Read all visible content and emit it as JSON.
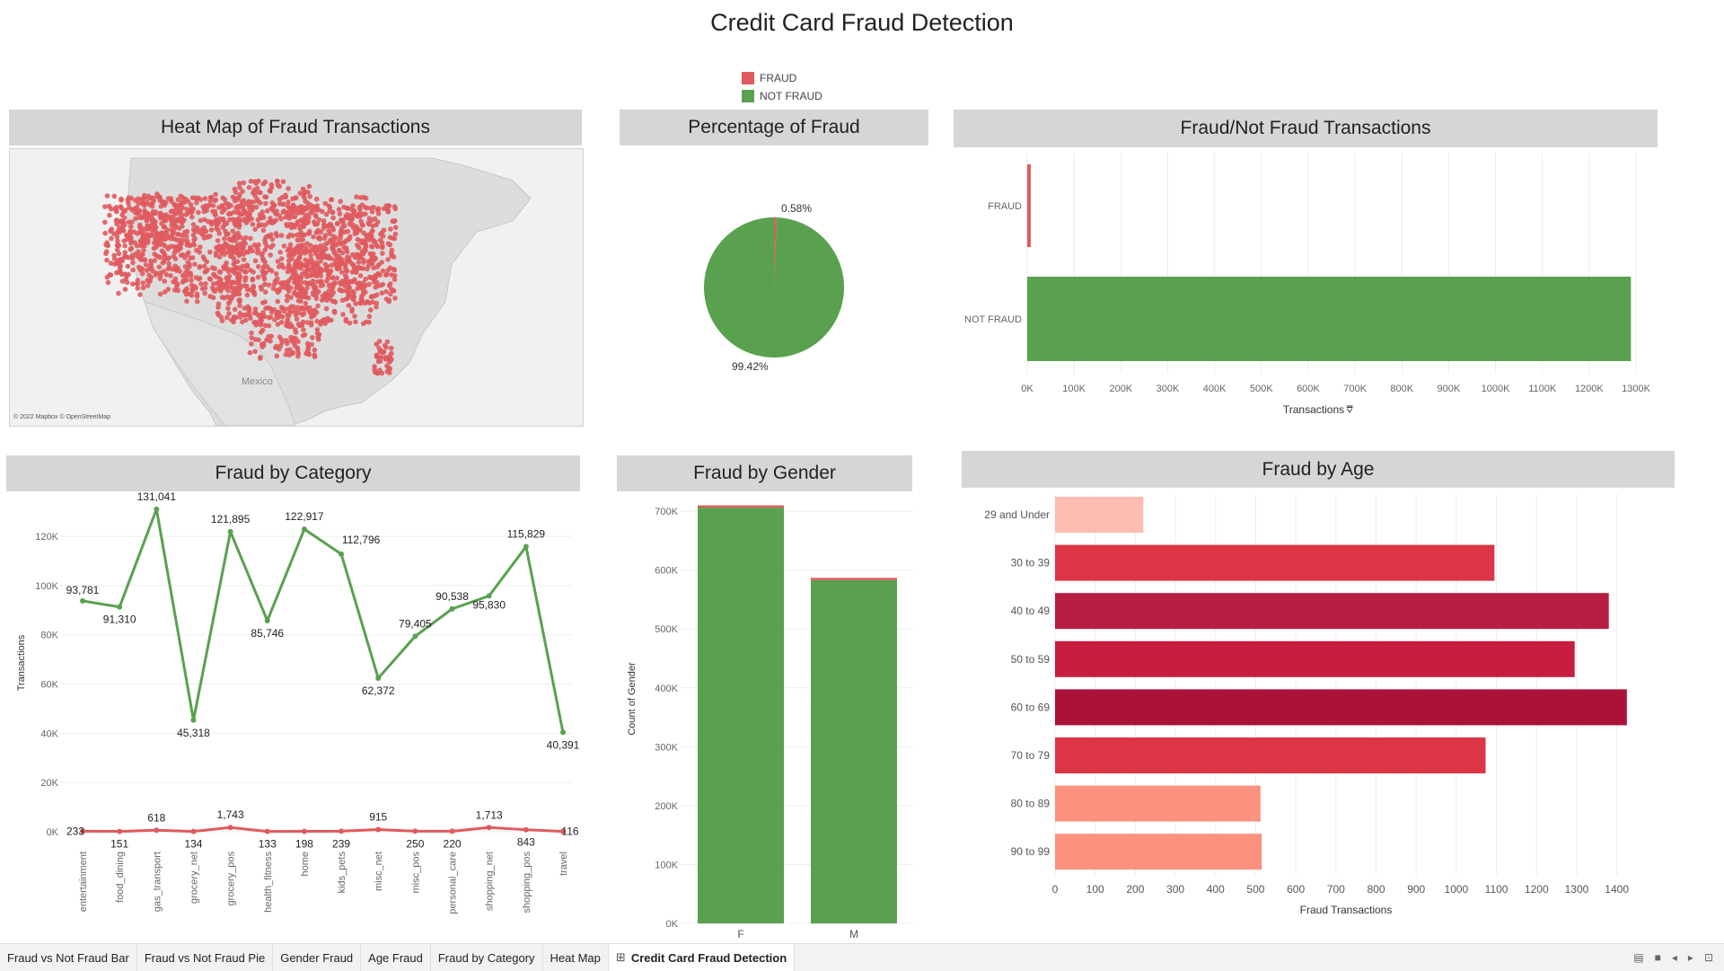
{
  "dashboard_title": "Credit Card Fraud Detection",
  "legend": [
    {
      "label": "FRAUD",
      "color": "#e05a5e"
    },
    {
      "label": "NOT FRAUD",
      "color": "#59a14f"
    }
  ],
  "panels": {
    "heatmap": {
      "title": "Heat Map of Fraud Transactions",
      "map_label": "Mexico",
      "attribution": "© 2022 Mapbox © OpenStreetMap"
    },
    "pie": {
      "title": "Percentage of Fraud"
    },
    "fraud_bar": {
      "title": "Fraud/Not Fraud Transactions"
    },
    "category": {
      "title": "Fraud by Category"
    },
    "gender": {
      "title": "Fraud by Gender"
    },
    "age": {
      "title": "Fraud by Age"
    }
  },
  "chart_data": [
    {
      "id": "pie",
      "type": "pie",
      "title": "Percentage of Fraud",
      "slices": [
        {
          "label": "FRAUD",
          "value": 0.58,
          "display": "0.58%",
          "color": "#e05a5e"
        },
        {
          "label": "NOT FRAUD",
          "value": 99.42,
          "display": "99.42%",
          "color": "#59a14f"
        }
      ]
    },
    {
      "id": "fraud_bar",
      "type": "bar",
      "orientation": "horizontal",
      "title": "Fraud/Not Fraud Transactions",
      "categories": [
        "FRAUD",
        "NOT FRAUD"
      ],
      "values": [
        7506,
        1289169
      ],
      "colors": [
        "#e05a5e",
        "#59a14f"
      ],
      "xlabel": "Transactions",
      "xlim": [
        0,
        1300000
      ],
      "xticks": [
        "0K",
        "100K",
        "200K",
        "300K",
        "400K",
        "500K",
        "600K",
        "700K",
        "800K",
        "900K",
        "1000K",
        "1100K",
        "1200K",
        "1300K"
      ]
    },
    {
      "id": "category",
      "type": "line",
      "title": "Fraud by Category",
      "ylabel": "Transactions",
      "ylim": [
        0,
        135000
      ],
      "yticks": [
        {
          "v": 0,
          "t": "0K"
        },
        {
          "v": 20000,
          "t": "20K"
        },
        {
          "v": 40000,
          "t": "40K"
        },
        {
          "v": 60000,
          "t": "60K"
        },
        {
          "v": 80000,
          "t": "80K"
        },
        {
          "v": 100000,
          "t": "100K"
        },
        {
          "v": 120000,
          "t": "120K"
        }
      ],
      "categories": [
        "entertainment",
        "food_dining",
        "gas_transport",
        "grocery_net",
        "grocery_pos",
        "health_fitness",
        "home",
        "kids_pets",
        "misc_net",
        "misc_pos",
        "personal_care",
        "shopping_net",
        "shopping_pos",
        "travel"
      ],
      "series": [
        {
          "name": "NOT FRAUD",
          "color": "#59a14f",
          "values": [
            93781,
            91310,
            131041,
            45318,
            121895,
            85746,
            122917,
            112796,
            62372,
            79405,
            90538,
            95830,
            115829,
            40391
          ],
          "labels": [
            "93,781",
            "91,310",
            "131,041",
            "45,318",
            "121,895",
            "85,746",
            "122,917",
            "112,796",
            "62,372",
            "79,405",
            "90,538",
            "95,830",
            "115,829",
            "40,391"
          ]
        },
        {
          "name": "FRAUD",
          "color": "#e05a5e",
          "values": [
            233,
            151,
            618,
            134,
            1743,
            133,
            198,
            239,
            915,
            250,
            220,
            1713,
            843,
            116
          ],
          "labels": [
            "233",
            "151",
            "618",
            "134",
            "1,743",
            "133",
            "198",
            "239",
            "915",
            "250",
            "220",
            "1,713",
            "843",
            "116"
          ]
        }
      ]
    },
    {
      "id": "gender",
      "type": "bar",
      "stacked": true,
      "title": "Fraud by Gender",
      "ylabel": "Count of Gender",
      "ylim": [
        0,
        720000
      ],
      "yticks": [
        "0K",
        "100K",
        "200K",
        "300K",
        "400K",
        "500K",
        "600K",
        "700K"
      ],
      "categories": [
        "F",
        "M"
      ],
      "series": [
        {
          "name": "NOT FRAUD",
          "color": "#59a14f",
          "values": [
            706128,
            583041
          ]
        },
        {
          "name": "FRAUD",
          "color": "#e05a5e",
          "values": [
            3735,
            3771
          ]
        }
      ]
    },
    {
      "id": "age",
      "type": "bar",
      "orientation": "horizontal",
      "title": "Fraud by Age",
      "xlabel": "Fraud Transactions",
      "xlim": [
        0,
        1450
      ],
      "xticks": [
        "0",
        "100",
        "200",
        "300",
        "400",
        "500",
        "600",
        "700",
        "800",
        "900",
        "1000",
        "1100",
        "1200",
        "1300",
        "1400"
      ],
      "categories": [
        "29 and Under",
        "30 to 39",
        "40 to 49",
        "50 to 59",
        "60 to 69",
        "70 to 79",
        "80 to 89",
        "90 to 99"
      ],
      "values": [
        220,
        1095,
        1380,
        1295,
        1425,
        1073,
        512,
        515
      ],
      "colors": [
        "#fdbcb1",
        "#dc3646",
        "#b71d41",
        "#c71d3e",
        "#ab1238",
        "#dc3646",
        "#fb927e",
        "#fb927e"
      ]
    }
  ],
  "tabs": [
    {
      "label": "Fraud vs Not Fraud Bar",
      "active": false
    },
    {
      "label": "Fraud vs Not Fraud Pie",
      "active": false
    },
    {
      "label": "Gender Fraud",
      "active": false
    },
    {
      "label": "Age Fraud",
      "active": false
    },
    {
      "label": "Fraud by Category",
      "active": false
    },
    {
      "label": "Heat Map",
      "active": false
    },
    {
      "label": "Credit Card Fraud Detection",
      "active": true,
      "icon": "dashboard-grid-icon"
    }
  ]
}
